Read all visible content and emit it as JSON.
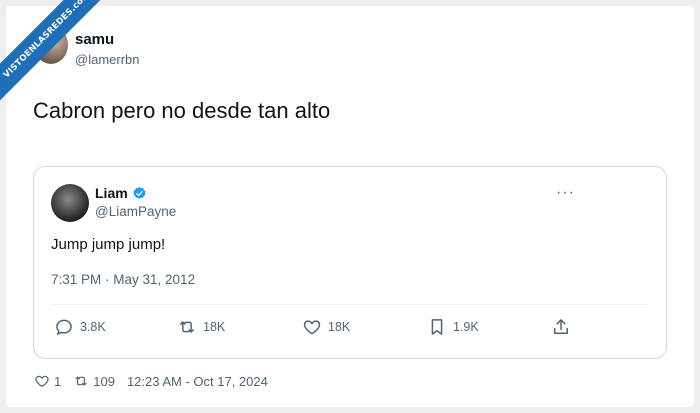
{
  "watermark": "VISTOENLASREDES.com",
  "tweet": {
    "author_name": "samu",
    "author_handle": "@lamerrbn",
    "text": "Cabron pero no desde tan alto",
    "footer": {
      "likes": "1",
      "retweets": "109",
      "timestamp": "12:23 AM - Oct 17, 2024"
    }
  },
  "quote": {
    "author_name": "Liam",
    "author_handle": "@LiamPayne",
    "text": "Jump jump jump!",
    "timestamp": "7:31 PM · May 31, 2012",
    "more_icon": "···",
    "actions": {
      "replies": "3.8K",
      "retweets": "18K",
      "likes": "18K",
      "bookmarks": "1.9K"
    }
  },
  "colors": {
    "verified": "#1d9bf0",
    "ribbon": "#1e6fb8",
    "muted": "#536471"
  }
}
